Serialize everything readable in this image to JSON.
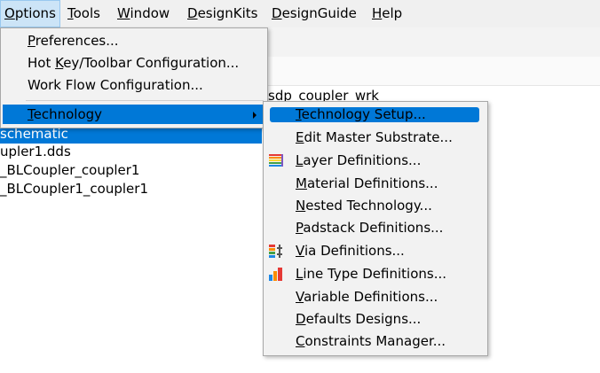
{
  "menubar": {
    "items": [
      {
        "first": "O",
        "rest": "ptions"
      },
      {
        "first": "T",
        "rest": "ools"
      },
      {
        "first": "W",
        "rest": "indow"
      },
      {
        "first": "D",
        "rest": "esignKits"
      },
      {
        "first": "D",
        "rest": "esignGuide"
      },
      {
        "first": "H",
        "rest": "elp"
      }
    ]
  },
  "workspace": {
    "label": "sdp_coupler_wrk",
    "tree": [
      "schematic",
      "upler1.dds",
      "_BLCoupler_coupler1",
      "_BLCoupler1_coupler1"
    ]
  },
  "options_menu": {
    "items": [
      {
        "first": "P",
        "rest": "references..."
      },
      {
        "pre": "Hot ",
        "first": "K",
        "rest": "ey/Toolbar Configuration..."
      },
      {
        "first": "W",
        "rest": "ork Flow Configuration..."
      },
      {
        "first": "T",
        "rest": "echnology"
      }
    ]
  },
  "technology_menu": {
    "items": [
      {
        "first": "T",
        "rest": "echnology Setup..."
      },
      {
        "first": "E",
        "rest": "dit Master Substrate..."
      },
      {
        "first": "L",
        "rest": "ayer Definitions...",
        "icon": "layers-icon"
      },
      {
        "first": "M",
        "rest": "aterial Definitions..."
      },
      {
        "first": "N",
        "rest": "ested Technology..."
      },
      {
        "first": "P",
        "rest": "adstack Definitions..."
      },
      {
        "first": "V",
        "rest": "ia Definitions...",
        "icon": "via-icon"
      },
      {
        "first": "L",
        "rest": "ine Type Definitions...",
        "icon": "line-type-icon"
      },
      {
        "first": "V",
        "rest": "ariable Definitions..."
      },
      {
        "first": "D",
        "rest": "efaults Designs..."
      },
      {
        "first": "C",
        "rest": "onstraints Manager..."
      }
    ]
  },
  "colors": {
    "highlight": "#0078d7",
    "menu_bg": "#f2f2f2",
    "menubar_active": "#cce4f7"
  }
}
